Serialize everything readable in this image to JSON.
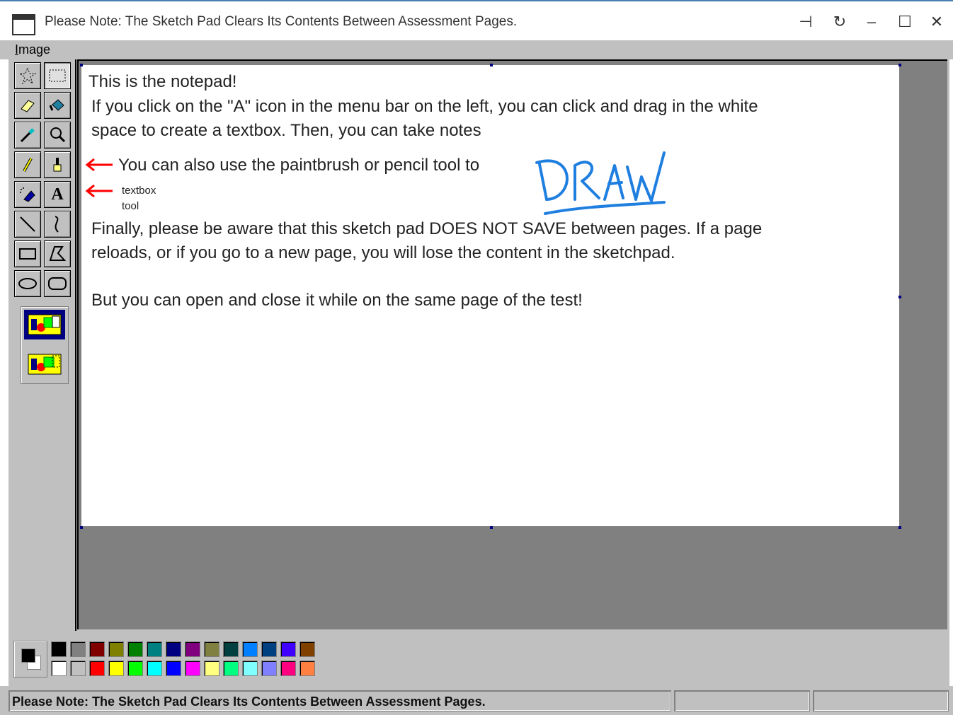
{
  "window": {
    "title": "Please Note: The Sketch Pad Clears Its Contents Between Assessment Pages.",
    "controls": {
      "pin": "⊣",
      "refresh": "↻",
      "minimize": "–",
      "maximize": "☐",
      "close": "✕"
    }
  },
  "menubar": {
    "items": [
      {
        "label_first": "I",
        "label_rest": "mage"
      }
    ]
  },
  "toolbox": {
    "tools": [
      {
        "name": "free-select",
        "icon": "free-select-icon",
        "glyph": "☆"
      },
      {
        "name": "rect-select",
        "icon": "rect-select-icon",
        "glyph": "⬚"
      },
      {
        "name": "eraser",
        "icon": "eraser-icon",
        "glyph": "⌫"
      },
      {
        "name": "fill",
        "icon": "paint-bucket-icon",
        "glyph": "◆"
      },
      {
        "name": "color-picker",
        "icon": "eyedropper-icon",
        "glyph": "⁄"
      },
      {
        "name": "magnifier",
        "icon": "magnifier-icon",
        "glyph": "⚲"
      },
      {
        "name": "pencil",
        "icon": "pencil-icon",
        "glyph": "✎"
      },
      {
        "name": "brush",
        "icon": "paintbrush-icon",
        "glyph": "♙"
      },
      {
        "name": "airbrush",
        "icon": "airbrush-icon",
        "glyph": "◥"
      },
      {
        "name": "text",
        "icon": "text-tool-icon",
        "glyph": "A"
      },
      {
        "name": "line",
        "icon": "line-icon",
        "glyph": "╲"
      },
      {
        "name": "curve",
        "icon": "curve-icon",
        "glyph": "≀"
      },
      {
        "name": "rectangle",
        "icon": "rectangle-icon",
        "glyph": "▭"
      },
      {
        "name": "polygon",
        "icon": "polygon-icon",
        "glyph": "▱"
      },
      {
        "name": "ellipse",
        "icon": "ellipse-icon",
        "glyph": "⬭"
      },
      {
        "name": "rounded-rect",
        "icon": "rounded-rect-icon",
        "glyph": "▢"
      }
    ],
    "active_tool": "rect-select"
  },
  "canvas": {
    "line1": "This is the notepad!",
    "line2": "If you click on the \"A\" icon in the menu bar on the left, you can click and drag in the white",
    "line3": "space to create a textbox. Then, you can take notes",
    "line4": "You can also use the paintbrush or pencil tool to",
    "drawn_word": "DRAW",
    "textbox_label_1": "textbox",
    "textbox_label_2": "tool",
    "line5": "Finally, please be aware that this sketch pad DOES NOT SAVE between pages. If a page",
    "line6": "reloads, or if you go to a new page, you will lose the content in the sketchpad.",
    "line7": "But you can open and close it while on the same page of the test!",
    "arrow_color": "#ff0000",
    "drawing_color": "#1f7fe0"
  },
  "palette": {
    "foreground": "#000000",
    "background": "#ffffff",
    "top_row": [
      "#000000",
      "#808080",
      "#800000",
      "#808000",
      "#008000",
      "#008080",
      "#000080",
      "#800080",
      "#808040",
      "#004040",
      "#0080ff",
      "#004080",
      "#4000ff",
      "#804000"
    ],
    "bottom_row": [
      "#ffffff",
      "#c0c0c0",
      "#ff0000",
      "#ffff00",
      "#00ff00",
      "#00ffff",
      "#0000ff",
      "#ff00ff",
      "#ffff80",
      "#00ff80",
      "#80ffff",
      "#8080ff",
      "#ff0080",
      "#ff8040"
    ]
  },
  "statusbar": {
    "text": "Please Note: The Sketch Pad Clears Its Contents Between Assessment Pages."
  }
}
